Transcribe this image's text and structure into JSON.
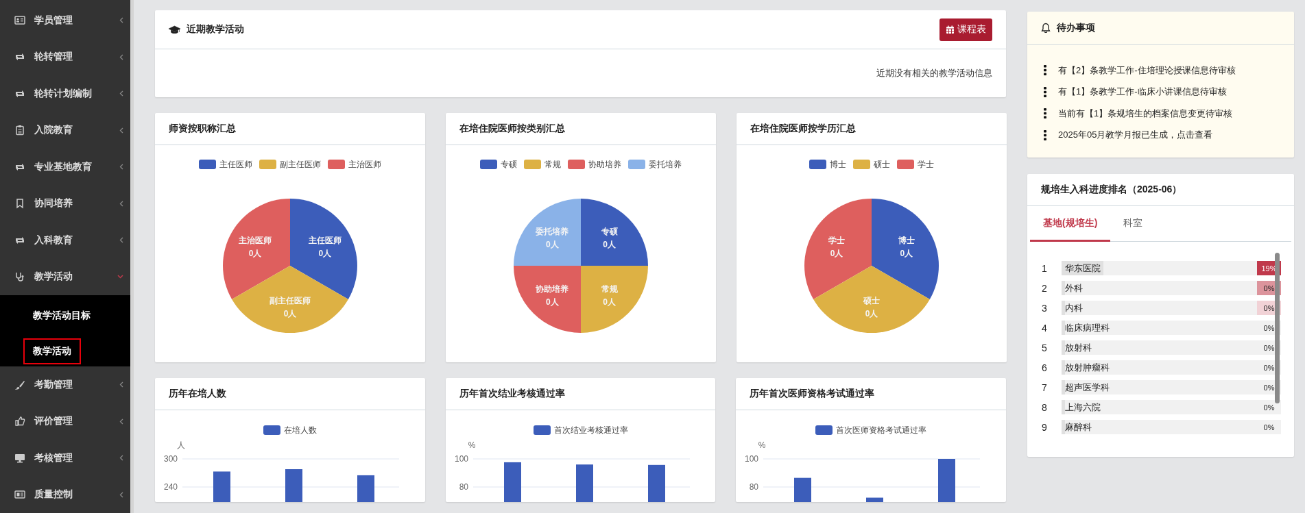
{
  "sidebar": {
    "items": [
      {
        "label": "学员管理",
        "expanded": false
      },
      {
        "label": "轮转管理",
        "expanded": false
      },
      {
        "label": "轮转计划编制",
        "expanded": false
      },
      {
        "label": "入院教育",
        "expanded": false
      },
      {
        "label": "专业基地教育",
        "expanded": false
      },
      {
        "label": "协同培养",
        "expanded": false
      },
      {
        "label": "入科教育",
        "expanded": false
      },
      {
        "label": "教学活动",
        "expanded": true,
        "children": [
          {
            "label": "教学活动目标",
            "selected": false
          },
          {
            "label": "教学活动",
            "selected": true
          }
        ]
      },
      {
        "label": "考勤管理",
        "expanded": false
      },
      {
        "label": "评价管理",
        "expanded": false
      },
      {
        "label": "考核管理",
        "expanded": false
      },
      {
        "label": "质量控制",
        "expanded": false
      }
    ]
  },
  "activity_panel": {
    "title": "近期教学活动",
    "button": "课程表",
    "message": "近期没有相关的教学活动信息"
  },
  "summary_cards": [
    {
      "title": "师资按职称汇总",
      "legend": [
        {
          "label": "主任医师",
          "color": "#3c5dba"
        },
        {
          "label": "副主任医师",
          "color": "#ddb144"
        },
        {
          "label": "主治医师",
          "color": "#de5f5e"
        }
      ],
      "pie": {
        "kind": "pie",
        "slices": [
          {
            "label": "主治医师",
            "value": "0人",
            "color": "#de5f5e"
          },
          {
            "label": "主任医师",
            "value": "0人",
            "color": "#3c5dba"
          },
          {
            "label": "副主任医师",
            "value": "0人",
            "color": "#ddb144"
          }
        ]
      }
    },
    {
      "title": "在培住院医师按类别汇总",
      "legend": [
        {
          "label": "专硕",
          "color": "#3c5dba"
        },
        {
          "label": "常规",
          "color": "#ddb144"
        },
        {
          "label": "协助培养",
          "color": "#de5f5e"
        },
        {
          "label": "委托培养",
          "color": "#8ab2e8"
        }
      ],
      "pie": {
        "kind": "pie",
        "slices": [
          {
            "label": "委托培养",
            "value": "0人",
            "color": "#8ab2e8"
          },
          {
            "label": "专硕",
            "value": "0人",
            "color": "#3c5dba"
          },
          {
            "label": "协助培养",
            "value": "0人",
            "color": "#de5f5e"
          },
          {
            "label": "常规",
            "value": "0人",
            "color": "#ddb144"
          }
        ]
      }
    },
    {
      "title": "在培住院医师按学历汇总",
      "legend": [
        {
          "label": "博士",
          "color": "#3c5dba"
        },
        {
          "label": "硕士",
          "color": "#ddb144"
        },
        {
          "label": "学士",
          "color": "#de5f5e"
        }
      ],
      "pie": {
        "kind": "pie",
        "slices": [
          {
            "label": "学士",
            "value": "0人",
            "color": "#de5f5e"
          },
          {
            "label": "博士",
            "value": "0人",
            "color": "#3c5dba"
          },
          {
            "label": "硕士",
            "value": "0人",
            "color": "#ddb144"
          }
        ]
      }
    }
  ],
  "trend_cards": [
    {
      "title": "历年在培人数",
      "chart_data": {
        "type": "bar",
        "ylabel": "人",
        "ylim": [
          180,
          300
        ],
        "yticks": [
          240,
          300
        ],
        "series": [
          {
            "name": "在培人数",
            "color": "#3c5dba",
            "values": [
              273,
              278,
              265
            ]
          }
        ]
      }
    },
    {
      "title": "历年首次结业考核通过率",
      "chart_data": {
        "type": "bar",
        "ylabel": "%",
        "ylim": [
          60,
          100
        ],
        "yticks": [
          80,
          100
        ],
        "series": [
          {
            "name": "首次结业考核通过率",
            "color": "#3c5dba",
            "values": [
              97.6,
              96,
              95.7
            ]
          }
        ]
      }
    },
    {
      "title": "历年首次医师资格考试通过率",
      "chart_data": {
        "type": "bar",
        "ylabel": "%",
        "ylim": [
          60,
          100
        ],
        "yticks": [
          80,
          100
        ],
        "series": [
          {
            "name": "首次医师资格考试通过率",
            "color": "#3c5dba",
            "values": [
              86.5,
              72.4,
              100
            ]
          }
        ]
      }
    }
  ],
  "todo": {
    "title": "待办事项",
    "items": [
      "有【2】条教学工作-住培理论授课信息待审核",
      "有【1】条教学工作-临床小讲课信息待审核",
      "当前有【1】条规培生的档案信息变更待审核",
      "2025年05月教学月报已生成，点击查看"
    ]
  },
  "ranking": {
    "title": "规培生入科进度排名（2025-06）",
    "tabs": [
      {
        "label": "基地(规培生)",
        "selected": true
      },
      {
        "label": "科室",
        "selected": false
      }
    ],
    "rows": [
      {
        "rank": "1",
        "name": "华东医院",
        "value": "19%",
        "level": 0.19,
        "color": "#c0394b"
      },
      {
        "rank": "2",
        "name": "外科",
        "value": "0%",
        "level": 0,
        "color": "#dc949c"
      },
      {
        "rank": "3",
        "name": "内科",
        "value": "0%",
        "level": 0,
        "color": "#f1d2d6"
      },
      {
        "rank": "4",
        "name": "临床病理科",
        "value": "0%",
        "level": 0
      },
      {
        "rank": "5",
        "name": "放射科",
        "value": "0%",
        "level": 0
      },
      {
        "rank": "6",
        "name": "放射肿瘤科",
        "value": "0%",
        "level": 0
      },
      {
        "rank": "7",
        "name": "超声医学科",
        "value": "0%",
        "level": 0
      },
      {
        "rank": "8",
        "name": "上海六院",
        "value": "0%",
        "level": 0
      },
      {
        "rank": "9",
        "name": "麻醉科",
        "value": "0%",
        "level": 0
      }
    ]
  }
}
